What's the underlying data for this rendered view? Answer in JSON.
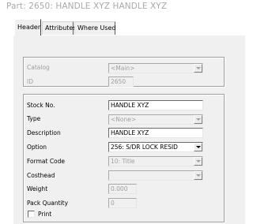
{
  "window": {
    "title": "Part: 2650: HANDLE XYZ  HANDLE XYZ"
  },
  "tabs": [
    {
      "label": "Header",
      "active": true
    },
    {
      "label": "Attributes",
      "active": false
    },
    {
      "label": "Where Used",
      "active": false
    }
  ],
  "top_group": {
    "catalog": {
      "label": "Catalog",
      "value": "<Main>",
      "enabled": false
    },
    "id": {
      "label": "ID",
      "value": "2650",
      "enabled": false
    }
  },
  "form": {
    "stock_no": {
      "label": "Stock No.",
      "value": "HANDLE XYZ"
    },
    "type": {
      "label": "Type",
      "value": "<None>",
      "enabled": false
    },
    "description": {
      "label": "Description",
      "value": "HANDLE XYZ"
    },
    "option": {
      "label": "Option",
      "value": "256: S/DR LOCK RESID"
    },
    "format_code": {
      "label": "Format Code",
      "value": "10: Title",
      "enabled": false
    },
    "costhead": {
      "label": "Costhead",
      "value": "",
      "enabled": false
    },
    "weight": {
      "label": "Weight",
      "value": "0.000",
      "enabled": false
    },
    "pack_quantity": {
      "label": "Pack Quantity",
      "value": "0",
      "enabled": false
    },
    "print": {
      "label": "Print",
      "checked": false
    }
  },
  "colors": {
    "panel_background": "#f0f0f0",
    "disabled_text": "#a0a0a0",
    "title_text": "#a9a9a9"
  }
}
